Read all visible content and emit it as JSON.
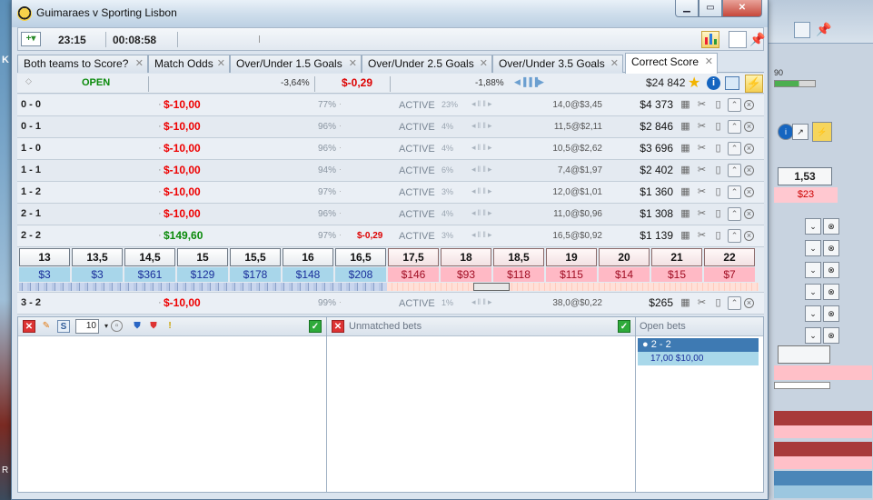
{
  "window": {
    "title": "Guimaraes v Sporting Lisbon",
    "controls": [
      "minimize",
      "maximize",
      "close"
    ]
  },
  "toolbar": {
    "time": "23:15",
    "elapsed": "00:08:58"
  },
  "tabs": [
    {
      "label": "Both teams to Score?"
    },
    {
      "label": "Match Odds"
    },
    {
      "label": "Over/Under 1.5 Goals"
    },
    {
      "label": "Over/Under 2.5 Goals"
    },
    {
      "label": "Over/Under 3.5 Goals"
    },
    {
      "label": "Correct Score",
      "active": true
    }
  ],
  "market": {
    "status": "OPEN",
    "back_pct": "-3,64%",
    "profit": "$-0,29",
    "lay_pct": "-1,88%",
    "matched": "$24 842"
  },
  "runners": [
    {
      "name": "0 - 0",
      "pl": "$-10,00",
      "pct": "77%",
      "pl2": "",
      "status": "ACTIVE",
      "pct2": "23%",
      "odds": "14,0@$3,45",
      "total": "$4 373"
    },
    {
      "name": "0 - 1",
      "pl": "$-10,00",
      "pct": "96%",
      "pl2": "",
      "status": "ACTIVE",
      "pct2": "4%",
      "odds": "11,5@$2,11",
      "total": "$2 846"
    },
    {
      "name": "1 - 0",
      "pl": "$-10,00",
      "pct": "96%",
      "pl2": "",
      "status": "ACTIVE",
      "pct2": "4%",
      "odds": "10,5@$2,62",
      "total": "$3 696"
    },
    {
      "name": "1 - 1",
      "pl": "$-10,00",
      "pct": "94%",
      "pl2": "",
      "status": "ACTIVE",
      "pct2": "6%",
      "odds": "7,4@$1,97",
      "total": "$2 402"
    },
    {
      "name": "1 - 2",
      "pl": "$-10,00",
      "pct": "97%",
      "pl2": "",
      "status": "ACTIVE",
      "pct2": "3%",
      "odds": "12,0@$1,01",
      "total": "$1 360"
    },
    {
      "name": "2 - 1",
      "pl": "$-10,00",
      "pct": "96%",
      "pl2": "",
      "status": "ACTIVE",
      "pct2": "4%",
      "odds": "11,0@$0,96",
      "total": "$1 308"
    },
    {
      "name": "2 - 2",
      "pl": "$149,60",
      "pct": "97%",
      "pl2": "$-0,29",
      "status": "ACTIVE",
      "pct2": "3%",
      "odds": "16,5@$0,92",
      "total": "$1 139"
    }
  ],
  "ladder": {
    "back": [
      {
        "odd": "13",
        "amount": "$3"
      },
      {
        "odd": "13,5",
        "amount": "$3"
      },
      {
        "odd": "14,5",
        "amount": "$361"
      },
      {
        "odd": "15",
        "amount": "$129"
      },
      {
        "odd": "15,5",
        "amount": "$178"
      },
      {
        "odd": "16",
        "amount": "$148"
      },
      {
        "odd": "16,5",
        "amount": "$208"
      }
    ],
    "lay": [
      {
        "odd": "17,5",
        "amount": "$146"
      },
      {
        "odd": "18",
        "amount": "$93"
      },
      {
        "odd": "18,5",
        "amount": "$118"
      },
      {
        "odd": "19",
        "amount": "$115"
      },
      {
        "odd": "20",
        "amount": "$14"
      },
      {
        "odd": "21",
        "amount": "$15"
      },
      {
        "odd": "22",
        "amount": "$7"
      }
    ]
  },
  "last_runner": {
    "name": "3 - 2",
    "pl": "$-10,00",
    "pct": "99%",
    "status": "ACTIVE",
    "pct2": "1%",
    "odds": "38,0@$0,22",
    "total": "$265"
  },
  "bottom": {
    "stake_value": "10",
    "unmatched_label": "Unmatched bets",
    "open_label": "Open bets",
    "open_bet": {
      "selection": "2 - 2",
      "detail": "17,00 $10,00"
    }
  },
  "background": {
    "right_odd": "1,53",
    "right_amount": "$23",
    "right_num": "90",
    "left_k": "K",
    "left_r": "R"
  },
  "colors": {
    "back": "#a8d6ea",
    "lay": "#ffb9c5",
    "loss": "#e00000",
    "profit": "#0a8a0a",
    "open_bet_header": "#3e7ab3"
  }
}
